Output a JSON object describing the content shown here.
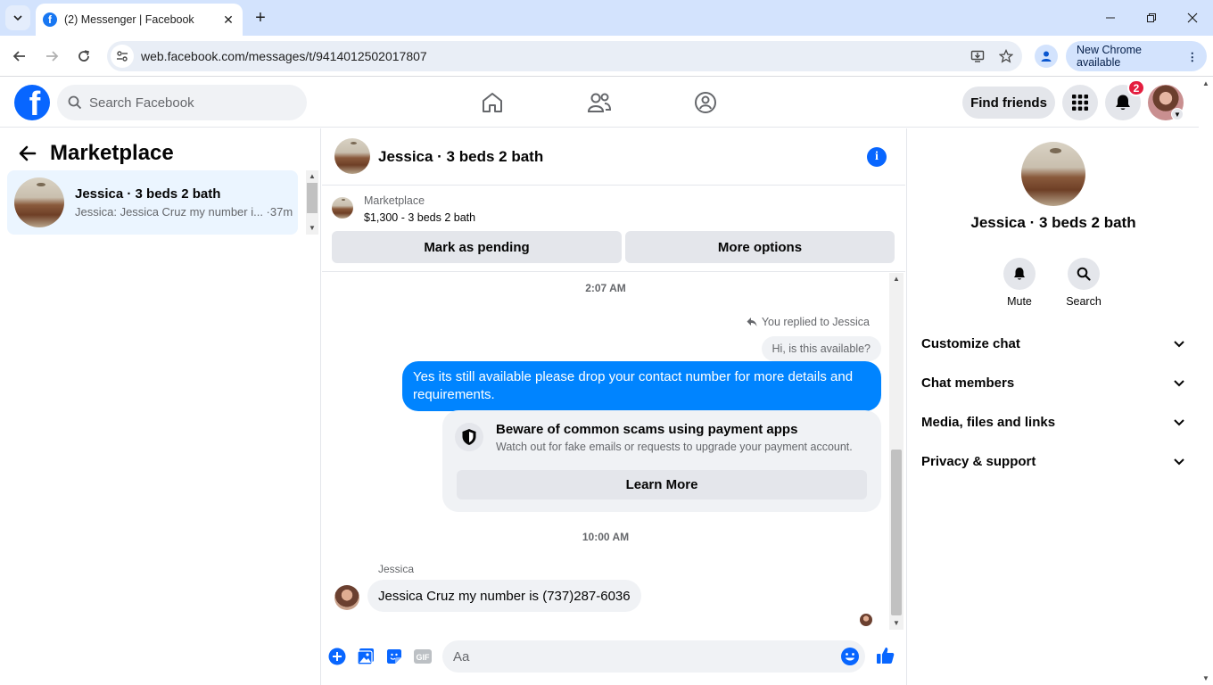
{
  "browser": {
    "tab_title": "(2) Messenger | Facebook",
    "url": "web.facebook.com/messages/t/9414012502017807",
    "update_label": "New Chrome available"
  },
  "fb": {
    "search_placeholder": "Search Facebook",
    "find_friends": "Find friends",
    "notification_count": "2"
  },
  "sidebar": {
    "title": "Marketplace",
    "conversations": [
      {
        "name": "Jessica · 3 beds 2 bath",
        "snippet": "Jessica: Jessica Cruz my number i... ·37m"
      }
    ]
  },
  "chat": {
    "title": "Jessica · 3 beds 2 bath",
    "listing_kind": "Marketplace",
    "listing_price": "$1,300 - 3 beds 2 bath",
    "mark_pending": "Mark as pending",
    "more_options": "More options",
    "time1": "2:07 AM",
    "reply_note": "You replied to Jessica",
    "quoted_text": "Hi, is this available?",
    "outgoing_text": "Yes its still available please drop your contact number for more details and requirements.",
    "scam_title": "Beware of common scams using payment apps",
    "scam_sub": "Watch out for fake emails or requests to upgrade your payment account.",
    "learn_more": "Learn More",
    "time2": "10:00 AM",
    "sender_name": "Jessica",
    "incoming_text": "Jessica Cruz my number is (737)287-6036",
    "composer_placeholder": "Aa"
  },
  "details": {
    "name": "Jessica · 3 beds 2 bath",
    "mute": "Mute",
    "search": "Search",
    "sections": [
      "Customize chat",
      "Chat members",
      "Media, files and links",
      "Privacy & support"
    ]
  },
  "colors": {
    "brand": "#0866ff",
    "outgoing_bubble": "#0084ff",
    "selected_row": "#ebf5ff",
    "badge": "#e41e3f"
  }
}
